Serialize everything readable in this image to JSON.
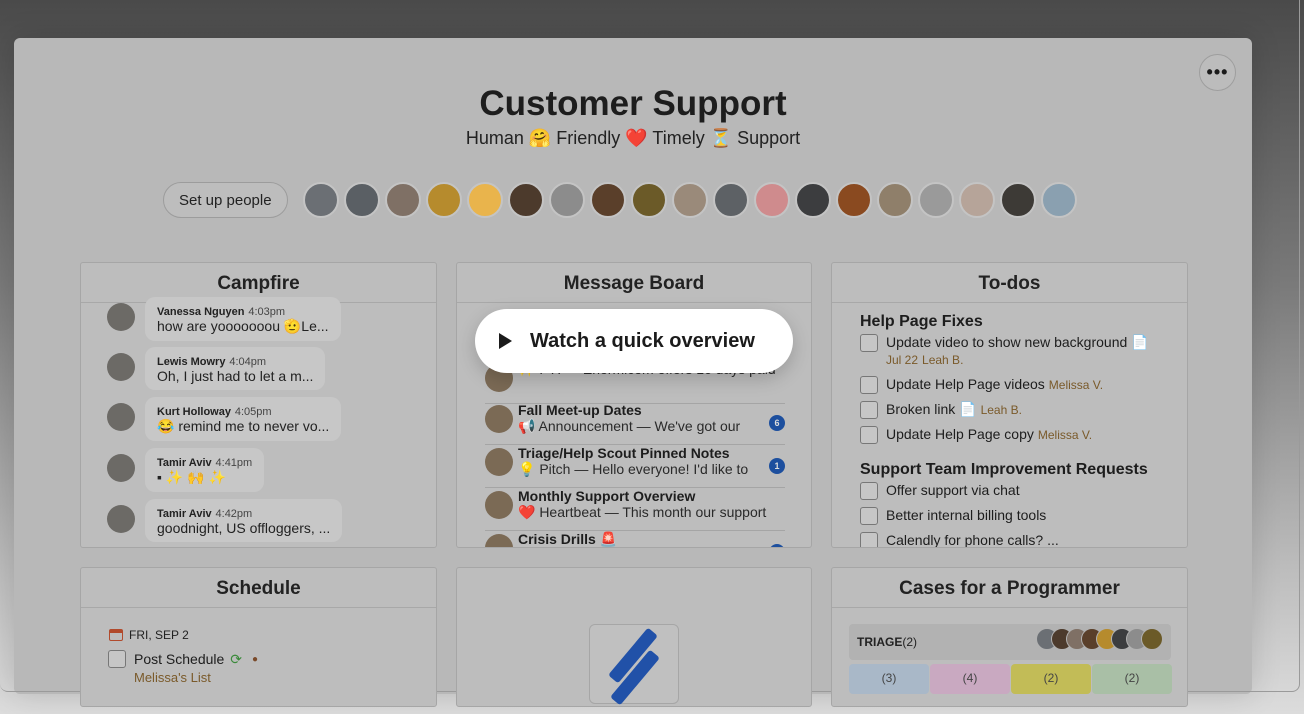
{
  "header": {
    "title": "Customer Support",
    "subtitle": "Human 🤗 Friendly ❤️ Timely ⏳ Support",
    "menu_label": "•••"
  },
  "people": {
    "setup_label": "Set up people",
    "avatar_colors": [
      "#6b6f74",
      "#5a5f64",
      "#7f7065",
      "#b68b2d",
      "#e9b44c",
      "#4c3a2c",
      "#8c8c8c",
      "#5a3f2a",
      "#6b5a28",
      "#9a8a7a",
      "#5d6165",
      "#cf8b8d",
      "#3c3d3f",
      "#8a4a20",
      "#8f7f6a",
      "#9a9a9a",
      "#b6a499",
      "#3d3a36",
      "#8aa0b0"
    ]
  },
  "campfire": {
    "title": "Campfire",
    "messages": [
      {
        "author": "Vanessa Nguyen",
        "time": "4:03pm",
        "text": "how are yooooooou 🫡Le..."
      },
      {
        "author": "Lewis Mowry",
        "time": "4:04pm",
        "text": "Oh, I just had to let a m..."
      },
      {
        "author": "Kurt Holloway",
        "time": "4:05pm",
        "text": "😂 remind me to never vo..."
      },
      {
        "author": "Tamir Aviv",
        "time": "4:41pm",
        "text": "▪ ✨ 🙌 ✨"
      },
      {
        "author": "Tamir Aviv",
        "time": "4:42pm",
        "text": "goodnight, US offloggers, ..."
      }
    ]
  },
  "message_board": {
    "title": "Message Board",
    "items": [
      {
        "title": "",
        "subtitle": "✨ FYI — Enormicom offers 16 days paid",
        "badge": ""
      },
      {
        "title": "Fall Meet-up Dates",
        "subtitle": "📢 Announcement — We've got our",
        "badge": "6"
      },
      {
        "title": "Triage/Help Scout Pinned Notes",
        "subtitle": "💡 Pitch — Hello everyone! I'd like to",
        "badge": "1"
      },
      {
        "title": "Monthly Support Overview",
        "subtitle": "❤️ Heartbeat — This month our support",
        "badge": ""
      },
      {
        "title": "Crisis Drills 🚨",
        "subtitle": "",
        "badge": "2"
      }
    ]
  },
  "overlay": {
    "label": "Watch a quick overview"
  },
  "todos": {
    "title": "To-dos",
    "groups": [
      {
        "name": "Help Page Fixes",
        "items": [
          {
            "text": "Update video to show new background 📄",
            "due": "Jul 22",
            "assignee": "Leah B."
          },
          {
            "text": "Update Help Page videos",
            "assignee": "Melissa V."
          },
          {
            "text": "Broken link 📄",
            "assignee": "Leah B."
          },
          {
            "text": "Update Help Page copy",
            "assignee": "Melissa V."
          }
        ]
      },
      {
        "name": "Support Team Improvement Requests",
        "items": [
          {
            "text": "Offer support via chat"
          },
          {
            "text": "Better internal billing tools"
          },
          {
            "text": "Calendly for phone calls? ..."
          }
        ]
      }
    ]
  },
  "schedule": {
    "title": "Schedule",
    "date": "FRI, SEP 2",
    "event": "Post Schedule",
    "event_list": "Melissa's List"
  },
  "cases": {
    "title": "Cases for a Programmer",
    "triage_label": "TRIAGE",
    "triage_count": "(2)",
    "columns": [
      {
        "count": "(3)",
        "color": "#a9b8c8"
      },
      {
        "count": "(4)",
        "color": "#c9a9c1"
      },
      {
        "count": "(2)",
        "color": "#c2bc57"
      },
      {
        "count": "(2)",
        "color": "#a9bfa6"
      }
    ]
  }
}
